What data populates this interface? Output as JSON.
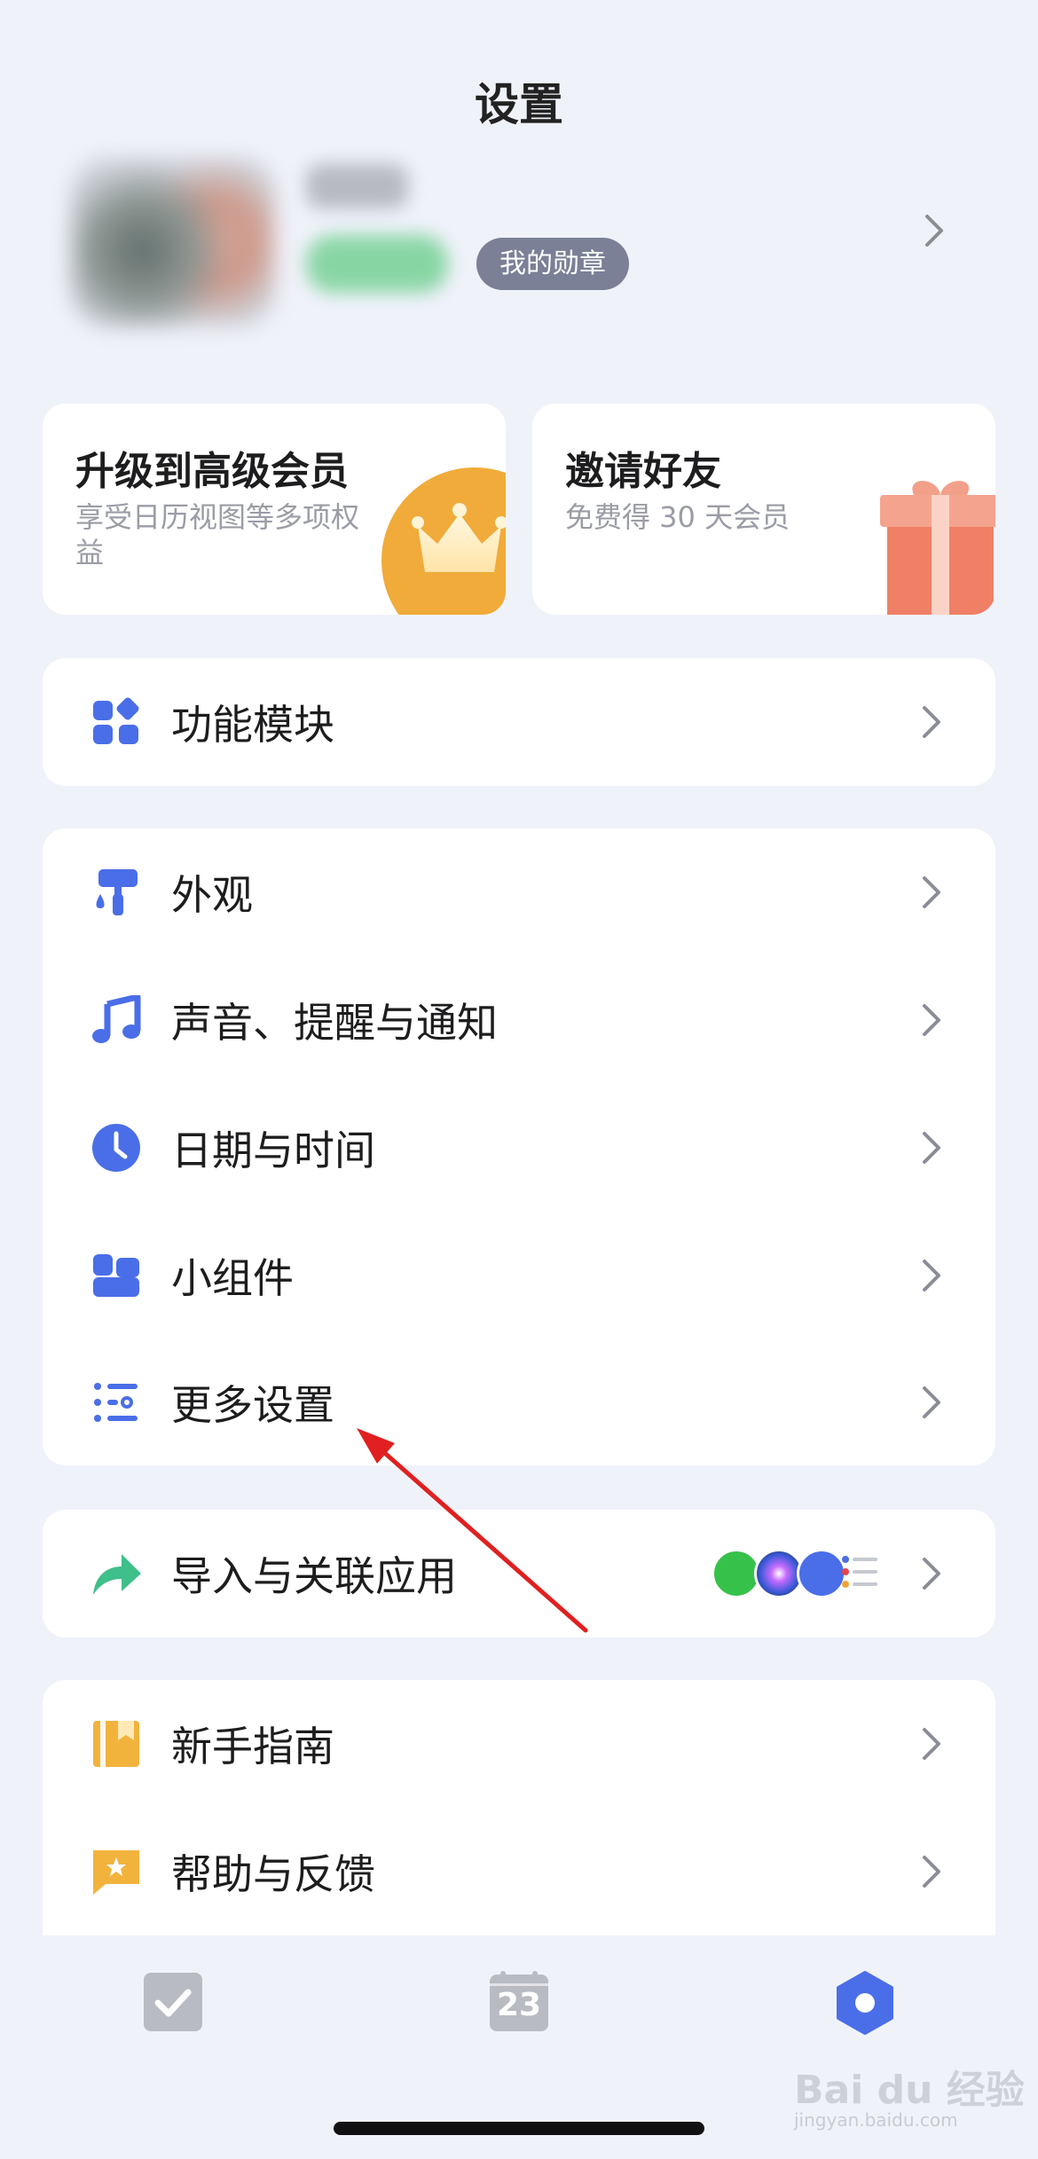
{
  "header": {
    "title": "设置"
  },
  "profile": {
    "badge_label": "我的勋章"
  },
  "promos": {
    "upgrade": {
      "title": "升级到高级会员",
      "subtitle": "享受日历视图等多项权益"
    },
    "invite": {
      "title": "邀请好友",
      "subtitle": "免费得 30 天会员"
    }
  },
  "modules": {
    "label": "功能模块"
  },
  "settings_group": {
    "items": [
      {
        "label": "外观",
        "icon": "paint-roller-icon"
      },
      {
        "label": "声音、提醒与通知",
        "icon": "music-note-icon"
      },
      {
        "label": "日期与时间",
        "icon": "clock-icon"
      },
      {
        "label": "小组件",
        "icon": "widget-icon"
      },
      {
        "label": "更多设置",
        "icon": "list-settings-icon"
      }
    ]
  },
  "import": {
    "label": "导入与关联应用",
    "apps": [
      "wechat-icon",
      "siri-icon",
      "calendar-app-icon",
      "reminders-icon"
    ]
  },
  "help_group": {
    "items": [
      {
        "label": "新手指南",
        "icon": "guide-book-icon"
      },
      {
        "label": "帮助与反馈",
        "icon": "feedback-icon"
      }
    ]
  },
  "tabbar": {
    "calendar_day": "23"
  },
  "watermark": {
    "text": "Bai du 经验",
    "sub": "jingyan.baidu.com"
  },
  "colors": {
    "accent": "#4a6ee8",
    "background": "#f0f2fa",
    "crown": "#f0ab3a",
    "gift": "#ef8066",
    "annotation_arrow": "#e02020"
  }
}
